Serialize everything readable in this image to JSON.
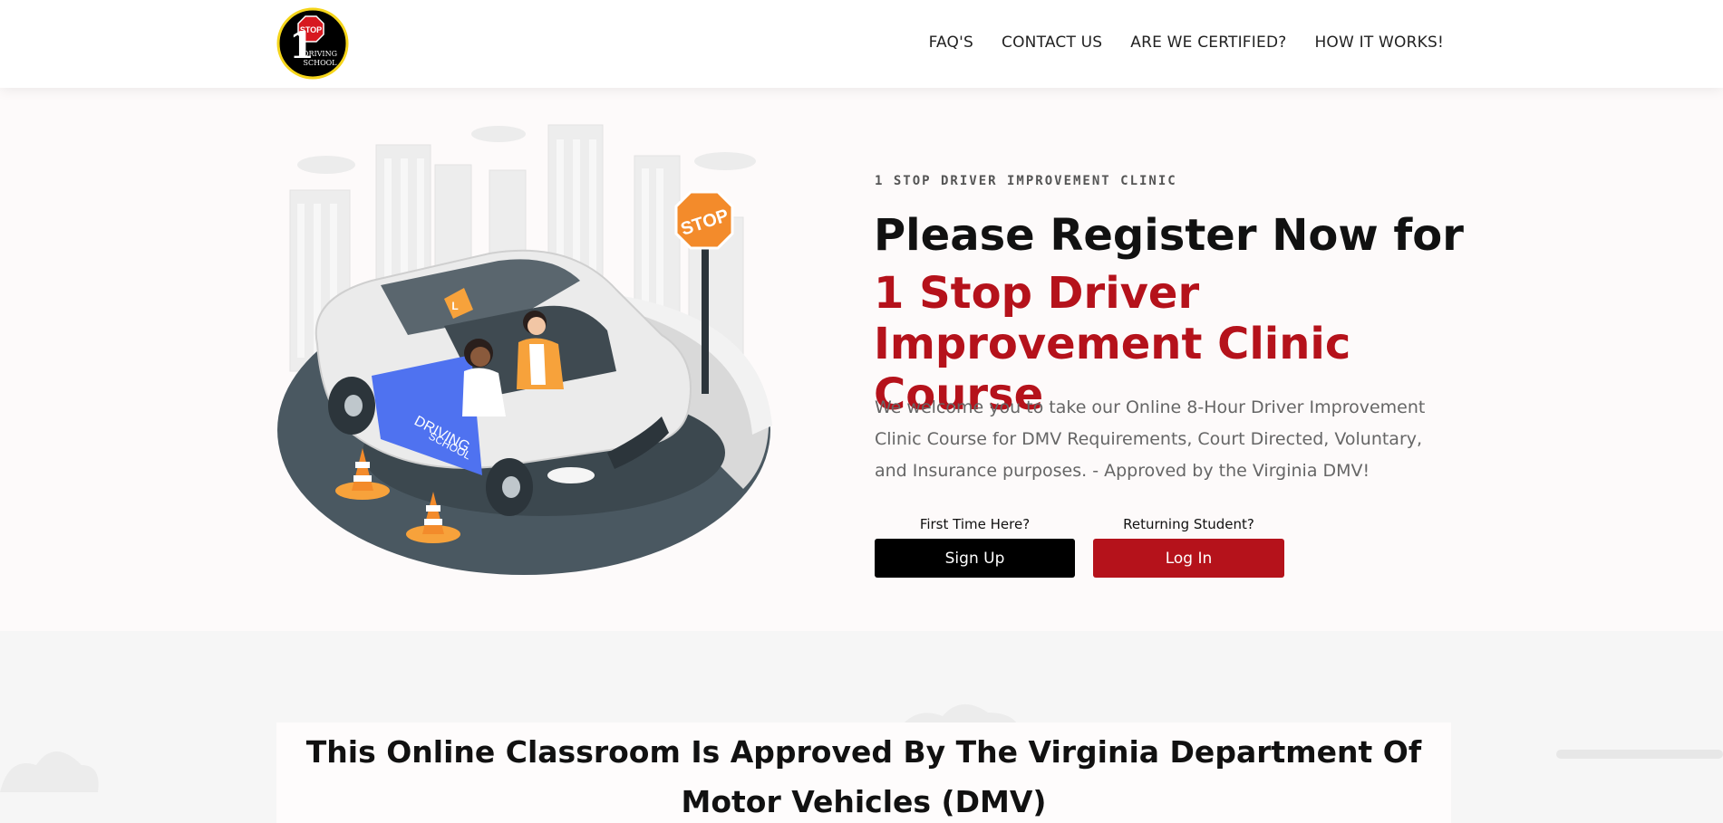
{
  "header": {
    "logo": {
      "line1": "1",
      "line2": "STOP",
      "line3": "DRIVING",
      "line4": "SCHOOL"
    },
    "nav": [
      {
        "label": "FAQ'S"
      },
      {
        "label": "CONTACT US"
      },
      {
        "label": "ARE WE CERTIFIED?"
      },
      {
        "label": "HOW IT WORKS!"
      }
    ]
  },
  "hero": {
    "illustration": {
      "door_text_1": "DRIVING",
      "door_text_2": "SCHOOL",
      "sign_text": "STOP",
      "roof_sign": "L"
    },
    "eyebrow": "1 STOP DRIVER IMPROVEMENT CLINIC",
    "title_line1": "Please Register Now for",
    "title_line2": "1 Stop Driver Improvement Clinic Course",
    "description": "We welcome you to take our Online 8-Hour Driver Improvement Clinic Course for DMV Requirements, Court Directed, Voluntary, and Insurance purposes. - Approved by the Virginia DMV!",
    "signup": {
      "prompt": "First Time Here?",
      "button": "Sign Up"
    },
    "login": {
      "prompt": "Returning Student?",
      "button": "Log In"
    }
  },
  "approval": {
    "title": "This Online Classroom Is Approved By The Virginia Department Of Motor Vehicles (DMV)"
  },
  "colors": {
    "brand_red": "#b5121b",
    "black": "#000000",
    "logo_yellow": "#f5d51b"
  }
}
